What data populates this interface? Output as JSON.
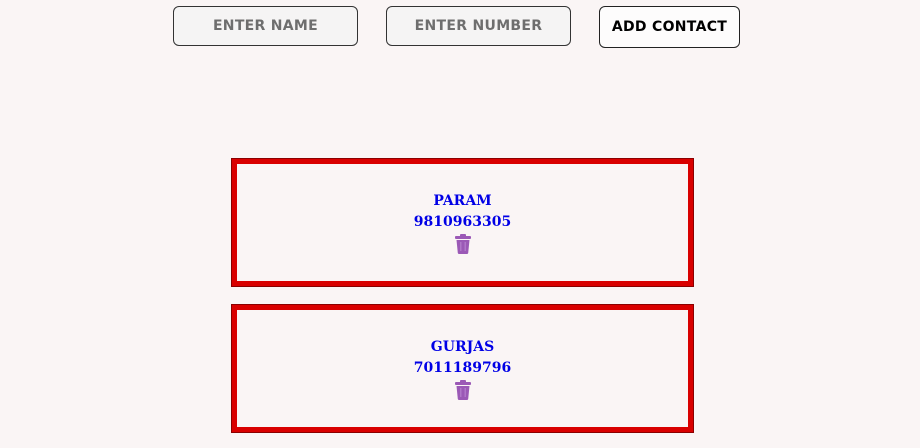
{
  "form": {
    "name_placeholder": "ENTER NAME",
    "number_placeholder": "ENTER NUMBER",
    "add_button_label": "ADD CONTACT"
  },
  "contacts": [
    {
      "name": "PARAM",
      "number": "9810963305",
      "delete_icon": "trash-icon"
    },
    {
      "name": "GURJAS",
      "number": "7011189796",
      "delete_icon": "trash-icon"
    }
  ],
  "colors": {
    "card_border": "#d90000",
    "contact_text": "#0000e6",
    "trash_icon": "#9b59b6",
    "background": "#faf5f5"
  }
}
